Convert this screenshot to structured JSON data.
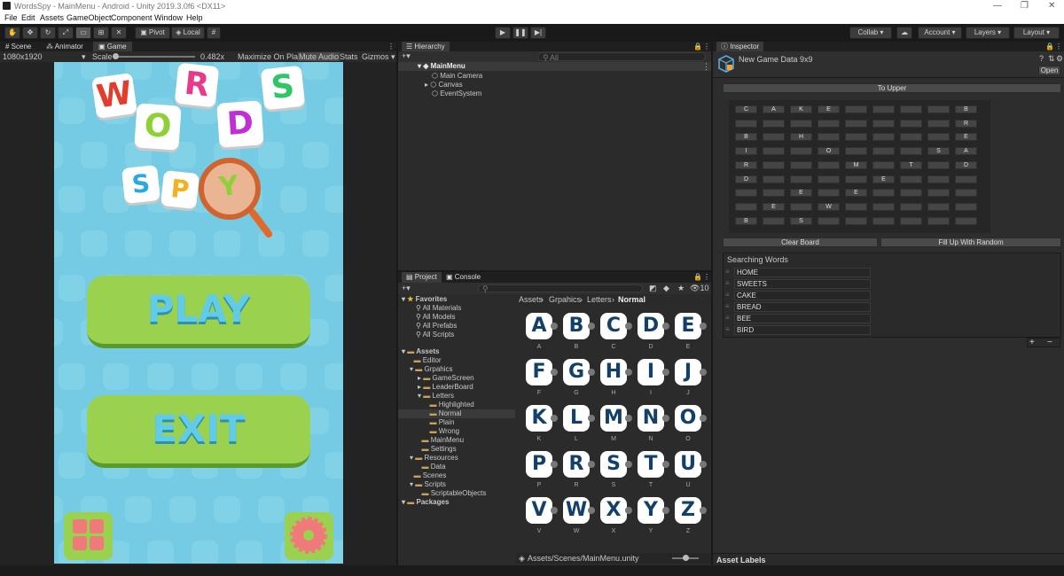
{
  "window": {
    "title": "WordsSpy - MainMenu - Android - Unity 2019.3.0f6 <DX11>",
    "controls": [
      "—",
      "❐",
      "✕"
    ]
  },
  "menu": [
    "File",
    "Edit",
    "Assets",
    "GameObject",
    "Component",
    "Window",
    "Help"
  ],
  "toolbar": {
    "pivot": "Pivot",
    "local": "Local",
    "collab": "Collab ▾",
    "account": "Account",
    "layers": "Layers",
    "layout": "Layout"
  },
  "gameview": {
    "tabs": [
      "Scene",
      "Animator",
      "Game"
    ],
    "resolution": "1080x1920",
    "scale_label": "Scale",
    "scale_value": "0.482x",
    "toggles": [
      "Maximize On Play",
      "Mute Audio",
      "Stats",
      "Gizmos ▾"
    ],
    "logo_letters": [
      "W",
      "O",
      "R",
      "D",
      "S",
      "S",
      "P",
      "Y"
    ],
    "play_label": "PLAY",
    "exit_label": "EXIT"
  },
  "hierarchy": {
    "tab": "Hierarchy",
    "search_placeholder": "All",
    "scene": "MainMenu",
    "items": [
      "Main Camera",
      "Canvas",
      "EventSystem"
    ]
  },
  "project": {
    "tabs": [
      "Project",
      "Console"
    ],
    "hidden_count": "10",
    "favorites": {
      "label": "Favorites",
      "items": [
        "All Materials",
        "All Models",
        "All Prefabs",
        "All Scripts"
      ]
    },
    "tree": [
      {
        "label": "Assets",
        "indent": 0,
        "bold": true
      },
      {
        "label": "Editor",
        "indent": 1
      },
      {
        "label": "Grpahics",
        "indent": 1
      },
      {
        "label": "GameScreen",
        "indent": 2
      },
      {
        "label": "LeaderBoard",
        "indent": 2
      },
      {
        "label": "Letters",
        "indent": 2
      },
      {
        "label": "Highlighted",
        "indent": 3
      },
      {
        "label": "Normal",
        "indent": 3,
        "selected": true
      },
      {
        "label": "Plain",
        "indent": 3
      },
      {
        "label": "Wrong",
        "indent": 3
      },
      {
        "label": "MainMenu",
        "indent": 2
      },
      {
        "label": "Settings",
        "indent": 2
      },
      {
        "label": "Resources",
        "indent": 1
      },
      {
        "label": "Data",
        "indent": 2
      },
      {
        "label": "Scenes",
        "indent": 1
      },
      {
        "label": "Scripts",
        "indent": 1
      },
      {
        "label": "ScriptableObjects",
        "indent": 2
      },
      {
        "label": "Packages",
        "indent": 0,
        "bold": true
      }
    ],
    "breadcrumb": [
      "Assets",
      "Grpahics",
      "Letters",
      "Normal"
    ],
    "assets": [
      "A",
      "B",
      "C",
      "D",
      "E",
      "F",
      "G",
      "H",
      "I",
      "J",
      "K",
      "L",
      "M",
      "N",
      "O",
      "P",
      "R",
      "S",
      "T",
      "U",
      "V",
      "W",
      "X",
      "Y",
      "Z"
    ],
    "status_path": "Assets/Scenes/MainMenu.unity"
  },
  "inspector": {
    "tab": "Inspector",
    "asset_name": "New Game Data 9x9",
    "open_label": "Open",
    "to_upper": "To Upper",
    "grid": [
      [
        "C",
        "A",
        "K",
        "E",
        "",
        "",
        "",
        "",
        "B"
      ],
      [
        "",
        "",
        "",
        "",
        "",
        "",
        "",
        "",
        "R"
      ],
      [
        "B",
        "",
        "H",
        "",
        "",
        "",
        "",
        "",
        "E"
      ],
      [
        "I",
        "",
        "",
        "O",
        "",
        "",
        "",
        "S",
        "A"
      ],
      [
        "R",
        "",
        "",
        "",
        "M",
        "",
        "T",
        "",
        "D"
      ],
      [
        "D",
        "",
        "",
        "",
        "",
        "E",
        "",
        "",
        ""
      ],
      [
        "",
        "",
        "E",
        "",
        "E",
        "",
        "",
        "",
        ""
      ],
      [
        "",
        "E",
        "",
        "W",
        "",
        "",
        "",
        "",
        ""
      ],
      [
        "B",
        "",
        "S",
        "",
        "",
        "",
        "",
        "",
        ""
      ]
    ],
    "clear_board": "Clear Board",
    "fill_random": "Fill Up With Random",
    "searching_words_label": "Searching Words",
    "words": [
      "HOME",
      "SWEETS",
      "CAKE",
      "BREAD",
      "BEE",
      "BIRD"
    ],
    "asset_labels": "Asset Labels"
  }
}
